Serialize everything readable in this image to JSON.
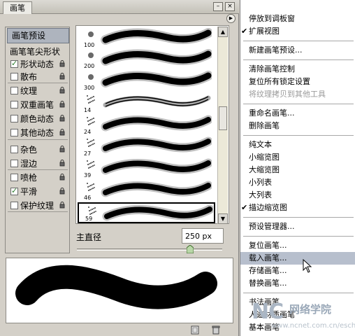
{
  "panel": {
    "tab_label": "画笔",
    "menu_button_icon": "triangle-right-icon",
    "window_buttons": [
      "minimize-icon",
      "close-icon"
    ],
    "preset_header": "画笔预设",
    "options": [
      {
        "label": "画笔笔尖形状",
        "checkbox": false,
        "checked": false,
        "lock": false
      },
      {
        "label": "形状动态",
        "checkbox": true,
        "checked": true,
        "lock": true
      },
      {
        "label": "散布",
        "checkbox": true,
        "checked": false,
        "lock": true
      },
      {
        "label": "纹理",
        "checkbox": true,
        "checked": false,
        "lock": true
      },
      {
        "label": "双重画笔",
        "checkbox": true,
        "checked": false,
        "lock": true
      },
      {
        "label": "颜色动态",
        "checkbox": true,
        "checked": false,
        "lock": true
      },
      {
        "label": "其他动态",
        "checkbox": true,
        "checked": false,
        "lock": true
      },
      {
        "label": "杂色",
        "checkbox": true,
        "checked": false,
        "lock": true
      },
      {
        "label": "湿边",
        "checkbox": true,
        "checked": false,
        "lock": true
      },
      {
        "label": "喷枪",
        "checkbox": true,
        "checked": false,
        "lock": true
      },
      {
        "label": "平滑",
        "checkbox": true,
        "checked": true,
        "lock": true
      },
      {
        "label": "保护纹理",
        "checkbox": true,
        "checked": false,
        "lock": true
      }
    ],
    "brushes": [
      {
        "size": "100",
        "style": "soft",
        "icon": "dot"
      },
      {
        "size": "200",
        "style": "soft",
        "icon": "dot"
      },
      {
        "size": "300",
        "style": "soft",
        "icon": "dot"
      },
      {
        "size": "14",
        "style": "rough",
        "icon": "splatter"
      },
      {
        "size": "24",
        "style": "splatter",
        "icon": "splatter"
      },
      {
        "size": "27",
        "style": "splatter",
        "icon": "splatter"
      },
      {
        "size": "39",
        "style": "splatter",
        "icon": "splatter"
      },
      {
        "size": "46",
        "style": "splatter",
        "icon": "splatter"
      },
      {
        "size": "59",
        "style": "splatter",
        "icon": "splatter",
        "selected": true
      }
    ],
    "diameter_label": "主直径",
    "diameter_value": "250 px",
    "diameter_slider_fraction": 0.78,
    "bottom_icons": [
      "new-preset-icon",
      "delete-icon"
    ]
  },
  "menu": {
    "items": [
      {
        "label": "停放到调板窗",
        "checked": false,
        "disabled": false
      },
      {
        "label": "扩展视图",
        "checked": true,
        "disabled": false
      },
      {
        "sep": true
      },
      {
        "label": "新建画笔预设...",
        "checked": false,
        "disabled": false
      },
      {
        "sep": true
      },
      {
        "label": "清除画笔控制",
        "checked": false,
        "disabled": false
      },
      {
        "label": "复位所有锁定设置",
        "checked": false,
        "disabled": false
      },
      {
        "label": "将纹理拷贝到其他工具",
        "checked": false,
        "disabled": true
      },
      {
        "sep": true
      },
      {
        "label": "重命名画笔...",
        "checked": false,
        "disabled": false
      },
      {
        "label": "删除画笔",
        "checked": false,
        "disabled": false
      },
      {
        "sep": true
      },
      {
        "label": "纯文本",
        "checked": false,
        "disabled": false
      },
      {
        "label": "小缩览图",
        "checked": false,
        "disabled": false
      },
      {
        "label": "大缩览图",
        "checked": false,
        "disabled": false
      },
      {
        "label": "小列表",
        "checked": false,
        "disabled": false
      },
      {
        "label": "大列表",
        "checked": false,
        "disabled": false
      },
      {
        "label": "描边缩览图",
        "checked": true,
        "disabled": false
      },
      {
        "sep": true
      },
      {
        "label": "预设管理器...",
        "checked": false,
        "disabled": false
      },
      {
        "sep": true
      },
      {
        "label": "复位画笔...",
        "checked": false,
        "disabled": false
      },
      {
        "label": "载入画笔...",
        "checked": false,
        "disabled": false,
        "highlighted": true
      },
      {
        "label": "存储画笔...",
        "checked": false,
        "disabled": false
      },
      {
        "label": "替换画笔...",
        "checked": false,
        "disabled": false
      },
      {
        "sep": true
      },
      {
        "label": "书法画笔",
        "checked": false,
        "disabled": false
      },
      {
        "label": "人造材质画笔",
        "checked": false,
        "disabled": false
      },
      {
        "label": "基本画笔",
        "checked": false,
        "disabled": false
      }
    ]
  },
  "cursor_icon": "mouse-pointer-icon",
  "watermark": {
    "logo": "NC",
    "title": "网络学院",
    "url": "www.ncnet.com.cn/eschool"
  }
}
